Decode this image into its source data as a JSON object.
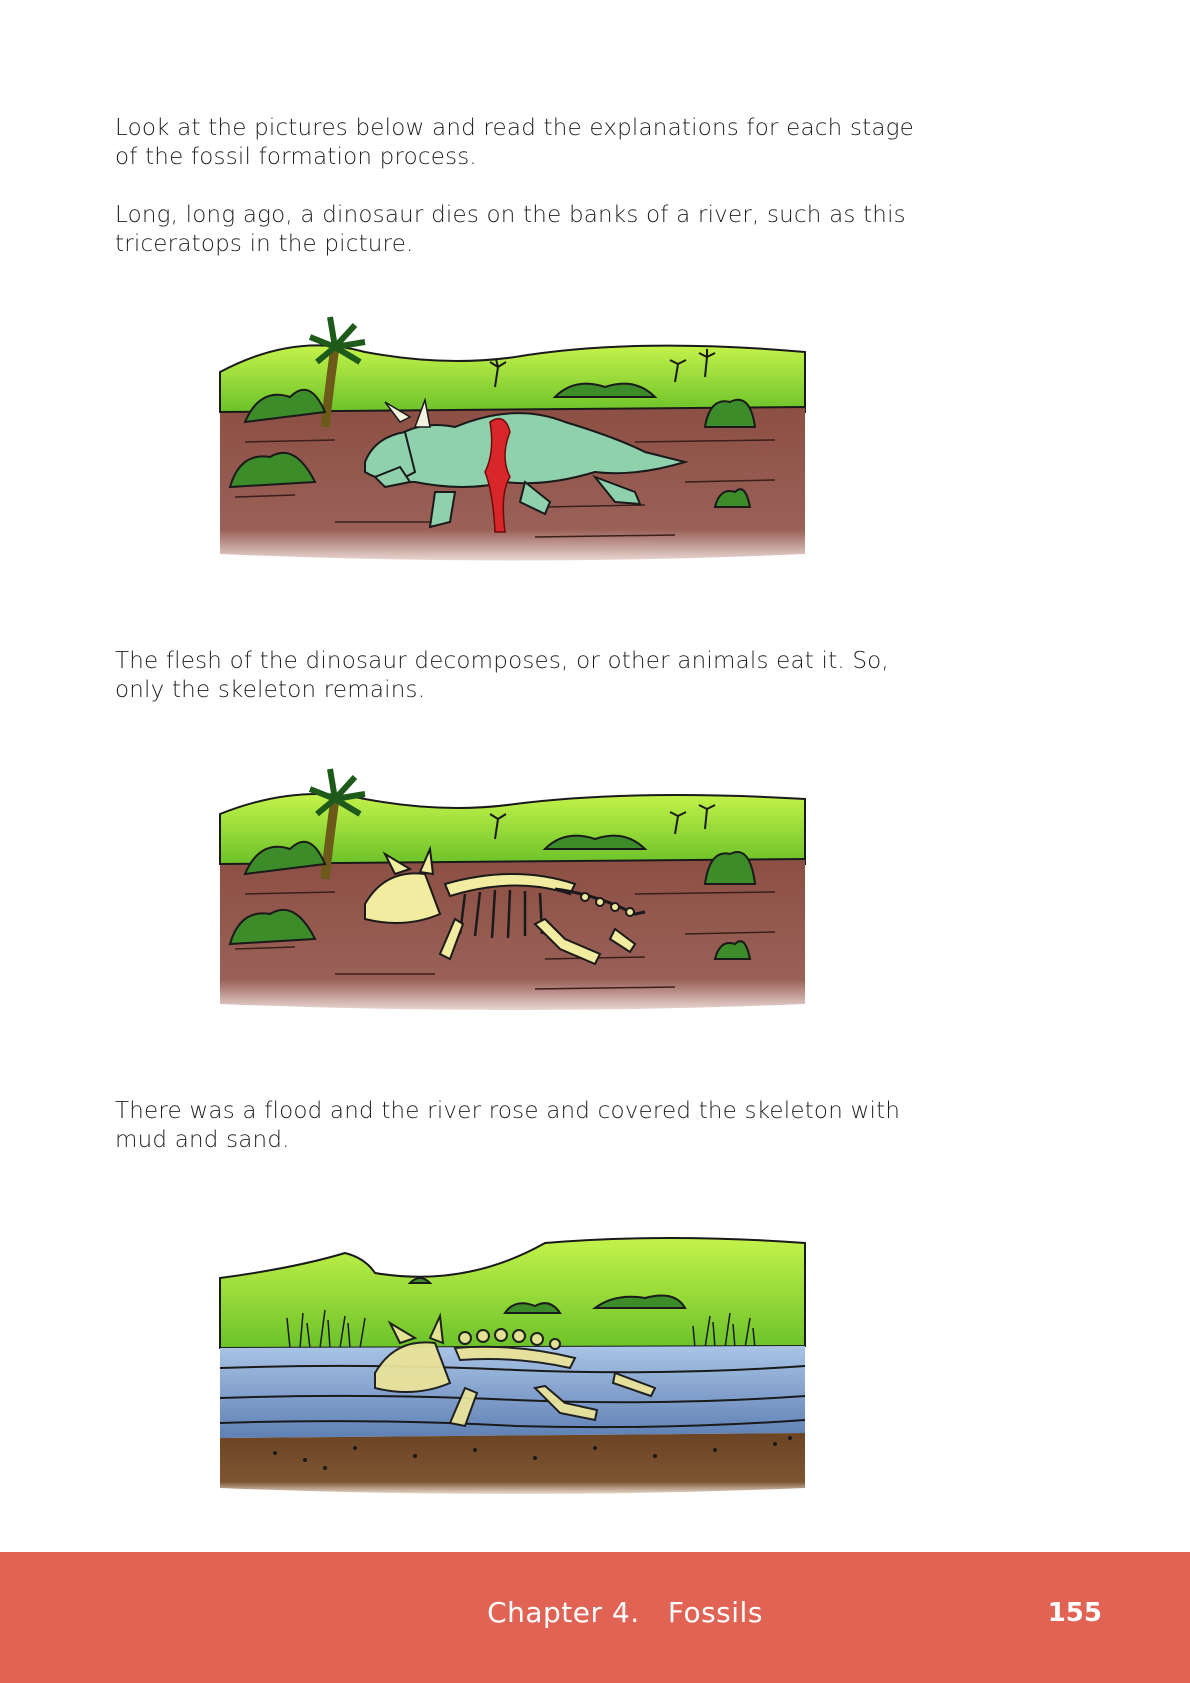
{
  "paragraphs": {
    "intro": "Look at the pictures below and read the explanations for each stage of the fossil formation process.",
    "stage1": "Long, long ago, a dinosaur dies on the banks of a river, such as this triceratops in the picture.",
    "stage2": "The flesh of the dinosaur decomposes, or other animals eat it. So, only the skeleton remains.",
    "stage3": "There was a flood and the river rose and covered the skeleton with mud and sand."
  },
  "illustrations": [
    {
      "name": "dead-triceratops-on-riverbank"
    },
    {
      "name": "triceratops-skeleton-on-riverbank"
    },
    {
      "name": "skeleton-covered-by-flood-water-and-mud"
    }
  ],
  "colors": {
    "footer_bg": "#e06354",
    "grass_light": "#b5ec3c",
    "grass_dark": "#5db323",
    "mud": "#8a4f45",
    "dinosaur": "#8fd0ad",
    "blood": "#d8262a",
    "bone": "#f1eca0",
    "water": "#6f93c4",
    "sediment": "#6b4423"
  },
  "footer": {
    "chapter_title": "Chapter 4.   Fossils",
    "page_number": "155"
  }
}
